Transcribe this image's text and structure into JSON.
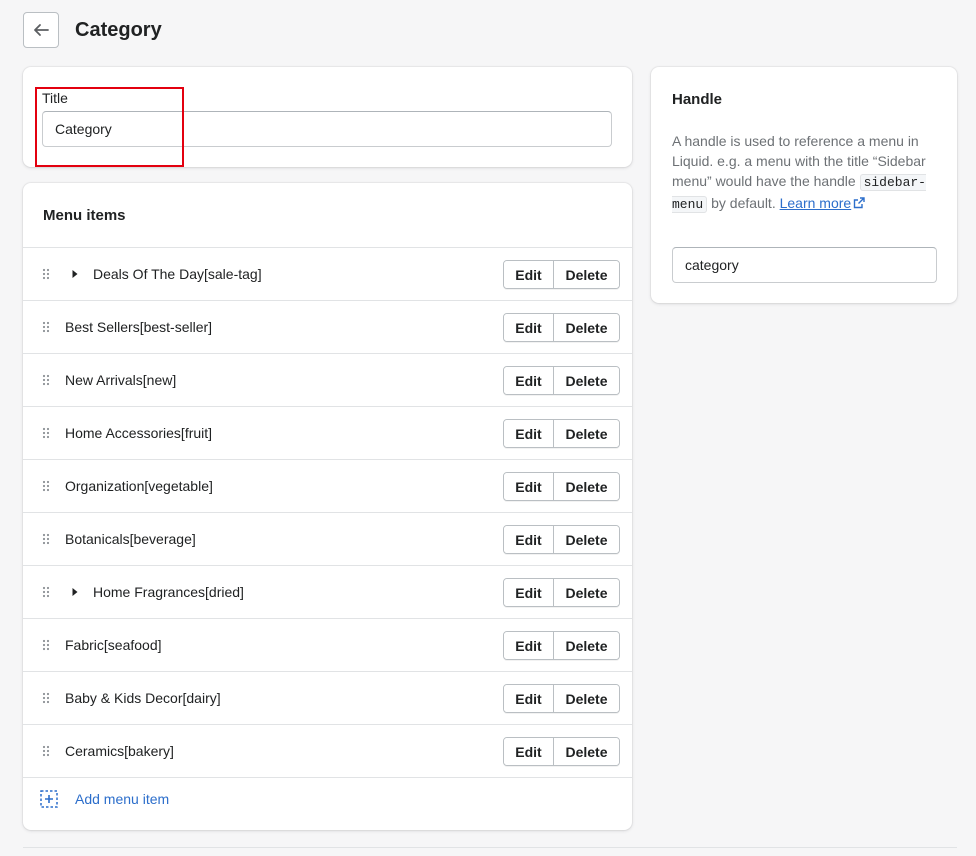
{
  "header": {
    "title": "Category",
    "back_icon": "arrow-left-icon"
  },
  "title_field": {
    "label": "Title",
    "value": "Category"
  },
  "menu": {
    "heading": "Menu items",
    "items": [
      {
        "label": "Deals Of The Day[sale-tag]",
        "expandable": true
      },
      {
        "label": "Best Sellers[best-seller]",
        "expandable": false
      },
      {
        "label": "New Arrivals[new]",
        "expandable": false
      },
      {
        "label": "Home Accessories[fruit]",
        "expandable": false
      },
      {
        "label": "Organization[vegetable]",
        "expandable": false
      },
      {
        "label": "Botanicals[beverage]",
        "expandable": false
      },
      {
        "label": "Home Fragrances[dried]",
        "expandable": true
      },
      {
        "label": "Fabric[seafood]",
        "expandable": false
      },
      {
        "label": "Baby & Kids Decor[dairy]",
        "expandable": false
      },
      {
        "label": "Ceramics[bakery]",
        "expandable": false
      }
    ],
    "edit_label": "Edit",
    "delete_label": "Delete",
    "add_label": "Add menu item"
  },
  "handle": {
    "heading": "Handle",
    "desc_part1": "A handle is used to reference a menu in Liquid. e.g. a menu with the title “Sidebar menu” would have the handle ",
    "code": "sidebar-menu",
    "desc_part2": " by default. ",
    "learn_more": "Learn more",
    "value": "category"
  },
  "colors": {
    "accent": "#2c6ecb",
    "highlight": "#e3000f",
    "background": "#f6f6f7"
  }
}
